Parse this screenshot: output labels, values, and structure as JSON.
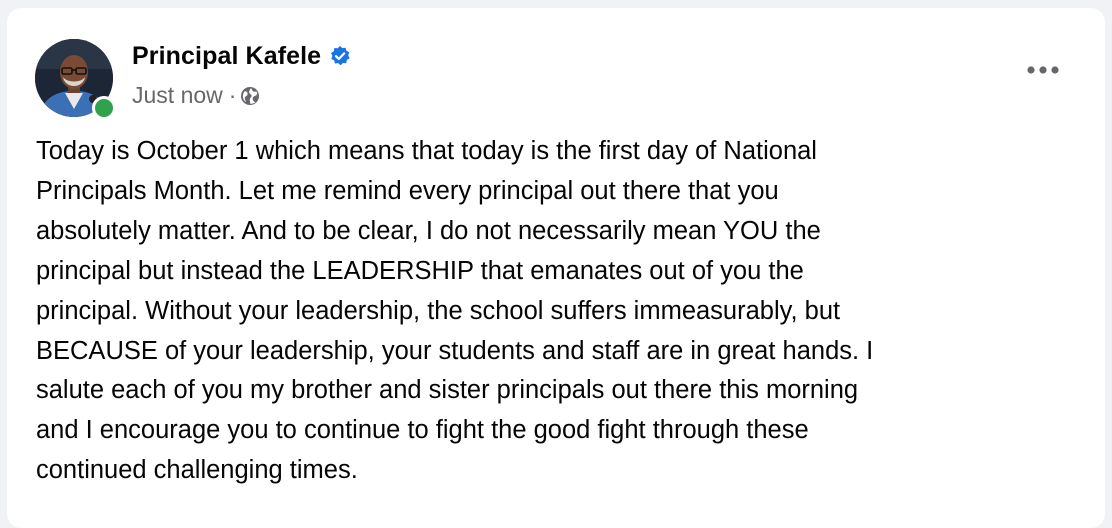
{
  "post": {
    "author": {
      "name": "Principal Kafele",
      "verified": true,
      "online": true
    },
    "meta": {
      "timestamp": "Just now",
      "separator": "·",
      "audience_icon": "globe-icon"
    },
    "menu_icon": "more-options-icon",
    "text": "Today is October 1 which means that today is the first day of National\nPrincipals Month. Let me remind every principal out there that you\nabsolutely matter. And to be clear, I do not necessarily mean YOU the\nprincipal but instead the LEADERSHIP that emanates out of you the\nprincipal. Without your leadership, the school suffers immeasurably, but\nBECAUSE of your leadership, your students and staff are in great hands. I\nsalute each of you my brother and sister principals out there this morning\nand I encourage you to continue to fight the good fight through these\ncontinued challenging times."
  },
  "colors": {
    "background": "#f0f2f5",
    "card": "#ffffff",
    "verified_blue": "#1b74e4",
    "online_green": "#31a24c",
    "meta_gray": "#65676b",
    "text": "#050505"
  }
}
